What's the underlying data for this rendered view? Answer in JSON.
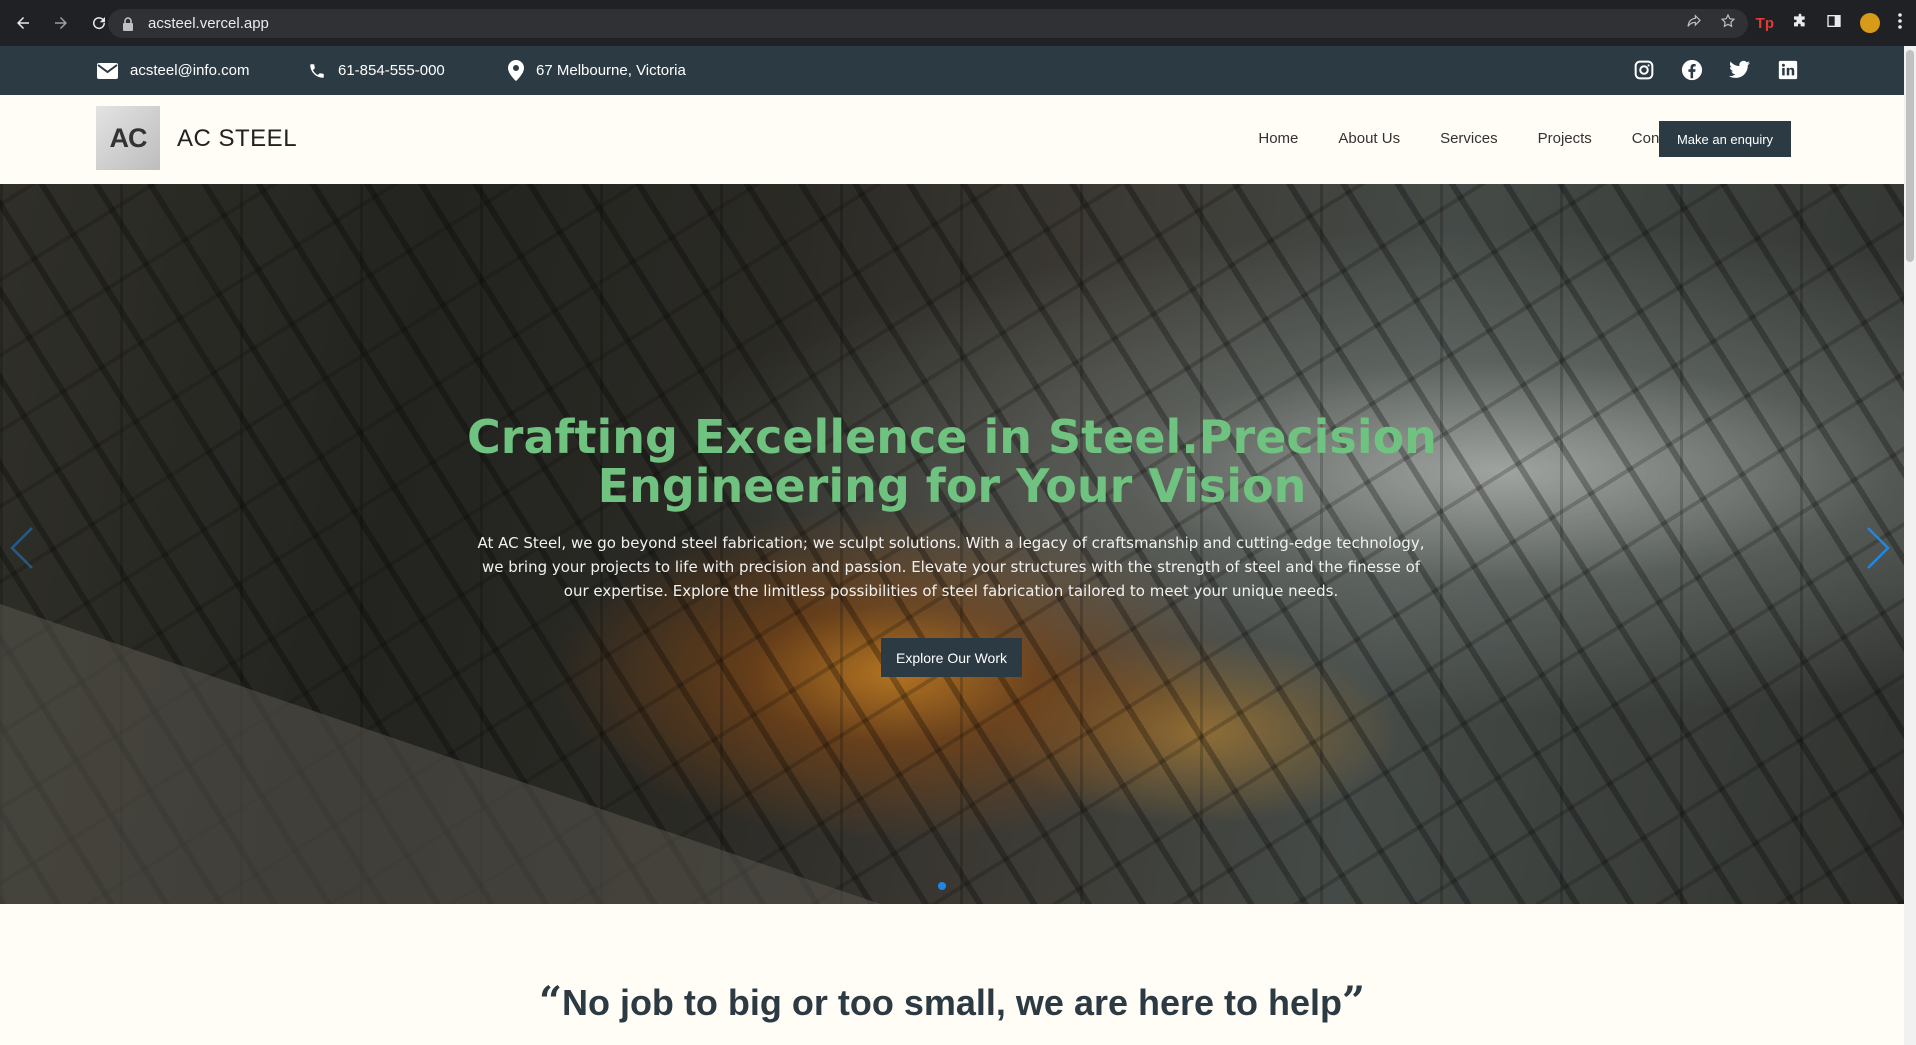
{
  "browser": {
    "url": "acsteel.vercel.app",
    "extension_badge": "Tp"
  },
  "topbar": {
    "email": "acsteel@info.com",
    "phone": "61-854-555-000",
    "address": "67 Melbourne, Victoria",
    "socials": [
      "instagram-icon",
      "facebook-icon",
      "twitter-icon",
      "linkedin-icon"
    ]
  },
  "header": {
    "logo_text": "AC",
    "brand": "AC STEEL",
    "nav": [
      "Home",
      "About Us",
      "Services",
      "Projects",
      "Contact Us"
    ],
    "cta": "Make an enquiry"
  },
  "hero": {
    "title": "Crafting Excellence in Steel.Precision Engineering for Your Vision",
    "description": "At AC Steel, we go beyond steel fabrication; we sculpt solutions. With a legacy of craftsmanship and cutting-edge technology, we bring your projects to life with precision and passion. Elevate your structures with the strength of steel and the finesse of our expertise. Explore the limitless possibilities of steel fabrication tailored to meet your unique needs.",
    "button": "Explore Our Work",
    "active_slide": 1
  },
  "quote": {
    "open": "“",
    "text": "No job to big or too small, we are here to help",
    "close": "”"
  },
  "colors": {
    "accent_dark": "#2c3a43",
    "hero_title": "#6fc27f",
    "carousel_arrow": "#1e88e5"
  }
}
